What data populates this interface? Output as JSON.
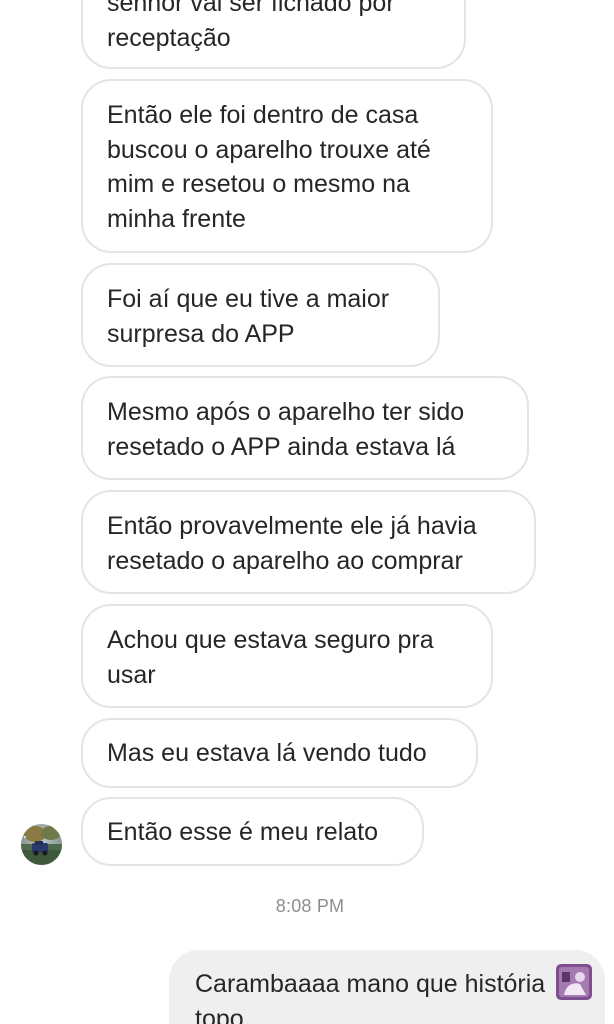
{
  "messages": [
    {
      "text": "senhor vai ser fichado por\nreceptação",
      "direction": "incoming"
    },
    {
      "text": "Então ele foi dentro de casa\nbuscou o aparelho trouxe até\nmim e resetou o mesmo na\nminha frente",
      "direction": "incoming"
    },
    {
      "text": "Foi aí que eu tive a maior\nsurpresa do APP",
      "direction": "incoming"
    },
    {
      "text": "Mesmo após o aparelho ter sido\nresetado o APP ainda estava lá",
      "direction": "incoming"
    },
    {
      "text": "Então provavelmente ele já havia\nresetado o aparelho ao comprar",
      "direction": "incoming"
    },
    {
      "text": "Achou que estava seguro pra\nusar",
      "direction": "incoming"
    },
    {
      "text": "Mas eu estava lá vendo tudo",
      "direction": "incoming"
    },
    {
      "text": "Então esse é meu relato",
      "direction": "incoming"
    },
    {
      "text": "Carambaaaa mano que história\ntopo",
      "direction": "outgoing"
    }
  ],
  "timestamp": "8:08 PM",
  "icons": {
    "sender_avatar": "profile-photo-avatar",
    "reaction_sticker": "purple-sticker-icon"
  },
  "colors": {
    "incoming_border": "#e4e4e6",
    "outgoing_bg": "#efefef",
    "text": "#262626",
    "timestamp": "#8e8e8e"
  }
}
